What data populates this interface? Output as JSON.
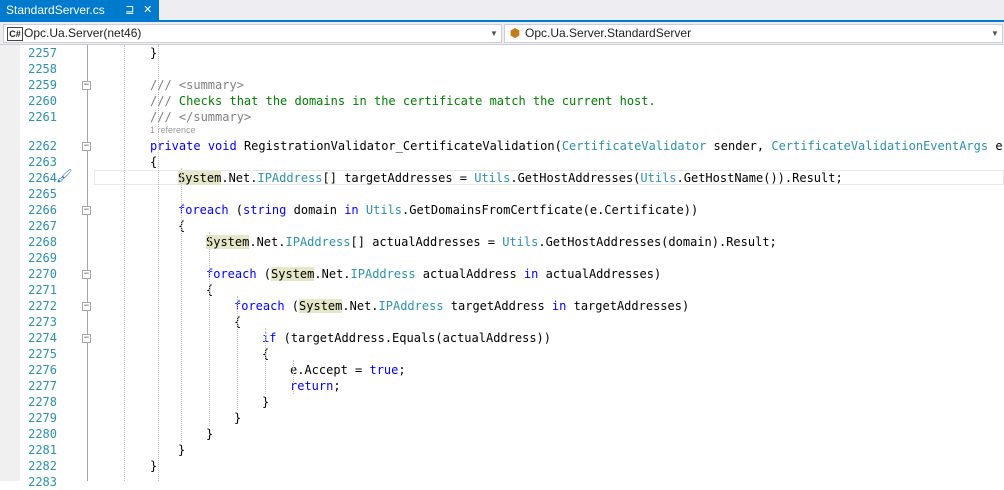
{
  "tab": {
    "title": "StandardServer.cs",
    "pin_icon": "pin-icon",
    "close_icon": "close-icon"
  },
  "nav": {
    "project_glyph": "C#",
    "project": "Opc.Ua.Server(net46)",
    "type": "Opc.Ua.Server.StandardServer"
  },
  "codelens": "1 reference",
  "lines": [
    {
      "n": "2257"
    },
    {
      "n": "2258"
    },
    {
      "n": "2259"
    },
    {
      "n": "2260"
    },
    {
      "n": "2261"
    },
    {
      "n": "2262"
    },
    {
      "n": "2263"
    },
    {
      "n": "2264"
    },
    {
      "n": "2265"
    },
    {
      "n": "2266"
    },
    {
      "n": "2267"
    },
    {
      "n": "2268"
    },
    {
      "n": "2269"
    },
    {
      "n": "2270"
    },
    {
      "n": "2271"
    },
    {
      "n": "2272"
    },
    {
      "n": "2273"
    },
    {
      "n": "2274"
    },
    {
      "n": "2275"
    },
    {
      "n": "2276"
    },
    {
      "n": "2277"
    },
    {
      "n": "2278"
    },
    {
      "n": "2279"
    },
    {
      "n": "2280"
    },
    {
      "n": "2281"
    },
    {
      "n": "2282"
    },
    {
      "n": "2283"
    }
  ],
  "code": {
    "l2257": [
      {
        "t": "}",
        "c": ""
      }
    ],
    "l2259": [
      {
        "t": "/// ",
        "c": "cg"
      },
      {
        "t": "<summary>",
        "c": "cg"
      }
    ],
    "l2260": [
      {
        "t": "/// ",
        "c": "cg"
      },
      {
        "t": "Checks that the domains in the certificate match the current host.",
        "c": "cm"
      }
    ],
    "l2261": [
      {
        "t": "/// ",
        "c": "cg"
      },
      {
        "t": "</summary>",
        "c": "cg"
      }
    ],
    "l2262": [
      {
        "t": "private",
        "c": "kw"
      },
      {
        "t": " ",
        "c": ""
      },
      {
        "t": "void",
        "c": "kw"
      },
      {
        "t": " RegistrationValidator_CertificateValidation(",
        "c": ""
      },
      {
        "t": "CertificateValidator",
        "c": "ty"
      },
      {
        "t": " sender, ",
        "c": ""
      },
      {
        "t": "CertificateValidationEventArgs",
        "c": "ty"
      },
      {
        "t": " e)",
        "c": ""
      }
    ],
    "l2263": [
      {
        "t": "{",
        "c": ""
      }
    ],
    "l2264": [
      {
        "t": "System",
        "c": "hl"
      },
      {
        "t": ".Net.",
        "c": ""
      },
      {
        "t": "IPAddress",
        "c": "ty"
      },
      {
        "t": "[] targetAddresses = ",
        "c": ""
      },
      {
        "t": "Utils",
        "c": "ty"
      },
      {
        "t": ".GetHostAddresses(",
        "c": ""
      },
      {
        "t": "Utils",
        "c": "ty"
      },
      {
        "t": ".GetHostName()).Result;",
        "c": ""
      }
    ],
    "l2266": [
      {
        "t": "foreach",
        "c": "kw"
      },
      {
        "t": " (",
        "c": ""
      },
      {
        "t": "string",
        "c": "kw"
      },
      {
        "t": " domain ",
        "c": ""
      },
      {
        "t": "in",
        "c": "kw"
      },
      {
        "t": " ",
        "c": ""
      },
      {
        "t": "Utils",
        "c": "ty"
      },
      {
        "t": ".GetDomainsFromCertficate(e.Certificate))",
        "c": ""
      }
    ],
    "l2267": [
      {
        "t": "{",
        "c": ""
      }
    ],
    "l2268": [
      {
        "t": "System",
        "c": "hl"
      },
      {
        "t": ".Net.",
        "c": ""
      },
      {
        "t": "IPAddress",
        "c": "ty"
      },
      {
        "t": "[] actualAddresses = ",
        "c": ""
      },
      {
        "t": "Utils",
        "c": "ty"
      },
      {
        "t": ".GetHostAddresses(domain).Result;",
        "c": ""
      }
    ],
    "l2270": [
      {
        "t": "foreach",
        "c": "kw"
      },
      {
        "t": " (",
        "c": ""
      },
      {
        "t": "System",
        "c": "hl"
      },
      {
        "t": ".Net.",
        "c": ""
      },
      {
        "t": "IPAddress",
        "c": "ty"
      },
      {
        "t": " actualAddress ",
        "c": ""
      },
      {
        "t": "in",
        "c": "kw"
      },
      {
        "t": " actualAddresses)",
        "c": ""
      }
    ],
    "l2271": [
      {
        "t": "{",
        "c": ""
      }
    ],
    "l2272": [
      {
        "t": "foreach",
        "c": "kw"
      },
      {
        "t": " (",
        "c": ""
      },
      {
        "t": "System",
        "c": "hl"
      },
      {
        "t": ".Net.",
        "c": ""
      },
      {
        "t": "IPAddress",
        "c": "ty"
      },
      {
        "t": " targetAddress ",
        "c": ""
      },
      {
        "t": "in",
        "c": "kw"
      },
      {
        "t": " targetAddresses)",
        "c": ""
      }
    ],
    "l2273": [
      {
        "t": "{",
        "c": ""
      }
    ],
    "l2274": [
      {
        "t": "if",
        "c": "kw"
      },
      {
        "t": " (targetAddress.Equals(actualAddress))",
        "c": ""
      }
    ],
    "l2275": [
      {
        "t": "{",
        "c": ""
      }
    ],
    "l2276": [
      {
        "t": "e.Accept = ",
        "c": ""
      },
      {
        "t": "true",
        "c": "kw"
      },
      {
        "t": ";",
        "c": ""
      }
    ],
    "l2277": [
      {
        "t": "return",
        "c": "kw"
      },
      {
        "t": ";",
        "c": ""
      }
    ],
    "l2278": [
      {
        "t": "}",
        "c": ""
      }
    ],
    "l2279": [
      {
        "t": "}",
        "c": ""
      }
    ],
    "l2280": [
      {
        "t": "}",
        "c": ""
      }
    ],
    "l2281": [
      {
        "t": "}",
        "c": ""
      }
    ],
    "l2282": [
      {
        "t": "}",
        "c": ""
      }
    ]
  },
  "colors": {
    "accent": "#007acc",
    "keyword": "#0000ff",
    "type": "#2b91af",
    "comment": "#008000",
    "line_number": "#2b91af"
  }
}
